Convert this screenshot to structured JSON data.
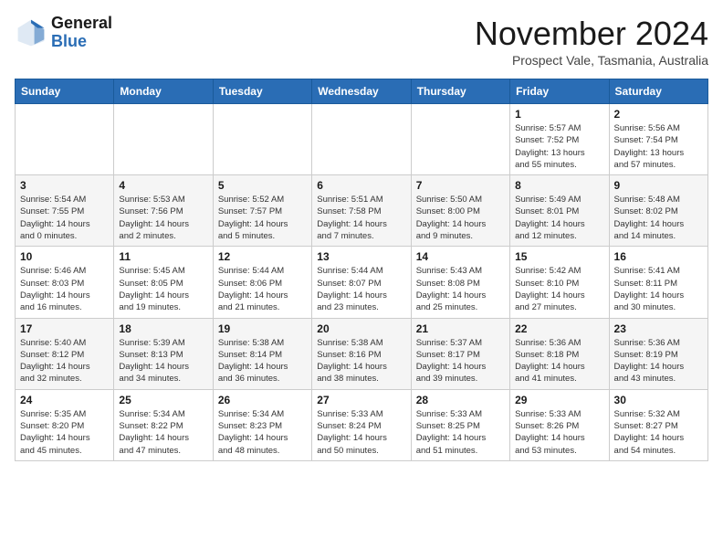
{
  "header": {
    "logo_line1": "General",
    "logo_line2": "Blue",
    "month": "November 2024",
    "location": "Prospect Vale, Tasmania, Australia"
  },
  "weekdays": [
    "Sunday",
    "Monday",
    "Tuesday",
    "Wednesday",
    "Thursday",
    "Friday",
    "Saturday"
  ],
  "weeks": [
    [
      {
        "day": "",
        "info": ""
      },
      {
        "day": "",
        "info": ""
      },
      {
        "day": "",
        "info": ""
      },
      {
        "day": "",
        "info": ""
      },
      {
        "day": "",
        "info": ""
      },
      {
        "day": "1",
        "info": "Sunrise: 5:57 AM\nSunset: 7:52 PM\nDaylight: 13 hours\nand 55 minutes."
      },
      {
        "day": "2",
        "info": "Sunrise: 5:56 AM\nSunset: 7:54 PM\nDaylight: 13 hours\nand 57 minutes."
      }
    ],
    [
      {
        "day": "3",
        "info": "Sunrise: 5:54 AM\nSunset: 7:55 PM\nDaylight: 14 hours\nand 0 minutes."
      },
      {
        "day": "4",
        "info": "Sunrise: 5:53 AM\nSunset: 7:56 PM\nDaylight: 14 hours\nand 2 minutes."
      },
      {
        "day": "5",
        "info": "Sunrise: 5:52 AM\nSunset: 7:57 PM\nDaylight: 14 hours\nand 5 minutes."
      },
      {
        "day": "6",
        "info": "Sunrise: 5:51 AM\nSunset: 7:58 PM\nDaylight: 14 hours\nand 7 minutes."
      },
      {
        "day": "7",
        "info": "Sunrise: 5:50 AM\nSunset: 8:00 PM\nDaylight: 14 hours\nand 9 minutes."
      },
      {
        "day": "8",
        "info": "Sunrise: 5:49 AM\nSunset: 8:01 PM\nDaylight: 14 hours\nand 12 minutes."
      },
      {
        "day": "9",
        "info": "Sunrise: 5:48 AM\nSunset: 8:02 PM\nDaylight: 14 hours\nand 14 minutes."
      }
    ],
    [
      {
        "day": "10",
        "info": "Sunrise: 5:46 AM\nSunset: 8:03 PM\nDaylight: 14 hours\nand 16 minutes."
      },
      {
        "day": "11",
        "info": "Sunrise: 5:45 AM\nSunset: 8:05 PM\nDaylight: 14 hours\nand 19 minutes."
      },
      {
        "day": "12",
        "info": "Sunrise: 5:44 AM\nSunset: 8:06 PM\nDaylight: 14 hours\nand 21 minutes."
      },
      {
        "day": "13",
        "info": "Sunrise: 5:44 AM\nSunset: 8:07 PM\nDaylight: 14 hours\nand 23 minutes."
      },
      {
        "day": "14",
        "info": "Sunrise: 5:43 AM\nSunset: 8:08 PM\nDaylight: 14 hours\nand 25 minutes."
      },
      {
        "day": "15",
        "info": "Sunrise: 5:42 AM\nSunset: 8:10 PM\nDaylight: 14 hours\nand 27 minutes."
      },
      {
        "day": "16",
        "info": "Sunrise: 5:41 AM\nSunset: 8:11 PM\nDaylight: 14 hours\nand 30 minutes."
      }
    ],
    [
      {
        "day": "17",
        "info": "Sunrise: 5:40 AM\nSunset: 8:12 PM\nDaylight: 14 hours\nand 32 minutes."
      },
      {
        "day": "18",
        "info": "Sunrise: 5:39 AM\nSunset: 8:13 PM\nDaylight: 14 hours\nand 34 minutes."
      },
      {
        "day": "19",
        "info": "Sunrise: 5:38 AM\nSunset: 8:14 PM\nDaylight: 14 hours\nand 36 minutes."
      },
      {
        "day": "20",
        "info": "Sunrise: 5:38 AM\nSunset: 8:16 PM\nDaylight: 14 hours\nand 38 minutes."
      },
      {
        "day": "21",
        "info": "Sunrise: 5:37 AM\nSunset: 8:17 PM\nDaylight: 14 hours\nand 39 minutes."
      },
      {
        "day": "22",
        "info": "Sunrise: 5:36 AM\nSunset: 8:18 PM\nDaylight: 14 hours\nand 41 minutes."
      },
      {
        "day": "23",
        "info": "Sunrise: 5:36 AM\nSunset: 8:19 PM\nDaylight: 14 hours\nand 43 minutes."
      }
    ],
    [
      {
        "day": "24",
        "info": "Sunrise: 5:35 AM\nSunset: 8:20 PM\nDaylight: 14 hours\nand 45 minutes."
      },
      {
        "day": "25",
        "info": "Sunrise: 5:34 AM\nSunset: 8:22 PM\nDaylight: 14 hours\nand 47 minutes."
      },
      {
        "day": "26",
        "info": "Sunrise: 5:34 AM\nSunset: 8:23 PM\nDaylight: 14 hours\nand 48 minutes."
      },
      {
        "day": "27",
        "info": "Sunrise: 5:33 AM\nSunset: 8:24 PM\nDaylight: 14 hours\nand 50 minutes."
      },
      {
        "day": "28",
        "info": "Sunrise: 5:33 AM\nSunset: 8:25 PM\nDaylight: 14 hours\nand 51 minutes."
      },
      {
        "day": "29",
        "info": "Sunrise: 5:33 AM\nSunset: 8:26 PM\nDaylight: 14 hours\nand 53 minutes."
      },
      {
        "day": "30",
        "info": "Sunrise: 5:32 AM\nSunset: 8:27 PM\nDaylight: 14 hours\nand 54 minutes."
      }
    ]
  ]
}
